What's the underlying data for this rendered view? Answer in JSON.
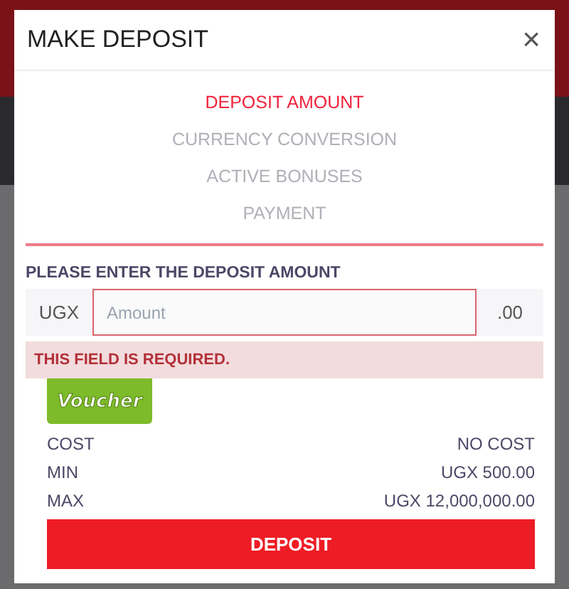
{
  "dialog": {
    "title": "MAKE DEPOSIT",
    "close": "×"
  },
  "steps": [
    {
      "label": "DEPOSIT AMOUNT",
      "selected": true
    },
    {
      "label": "CURRENCY CONVERSION",
      "selected": false
    },
    {
      "label": "ACTIVE BONUSES",
      "selected": false
    },
    {
      "label": "PAYMENT",
      "selected": false
    }
  ],
  "amount": {
    "label": "PLEASE ENTER THE DEPOSIT AMOUNT",
    "currency": "UGX",
    "placeholder": "Amount",
    "suffix": ".00",
    "error": "THIS FIELD IS REQUIRED."
  },
  "voucher": "Voucher",
  "limits": [
    {
      "name": "COST",
      "value": "NO COST"
    },
    {
      "name": "MIN",
      "value": "UGX 500.00"
    },
    {
      "name": "MAX",
      "value": "UGX 12,000,000.00"
    }
  ],
  "submit": "DEPOSIT"
}
